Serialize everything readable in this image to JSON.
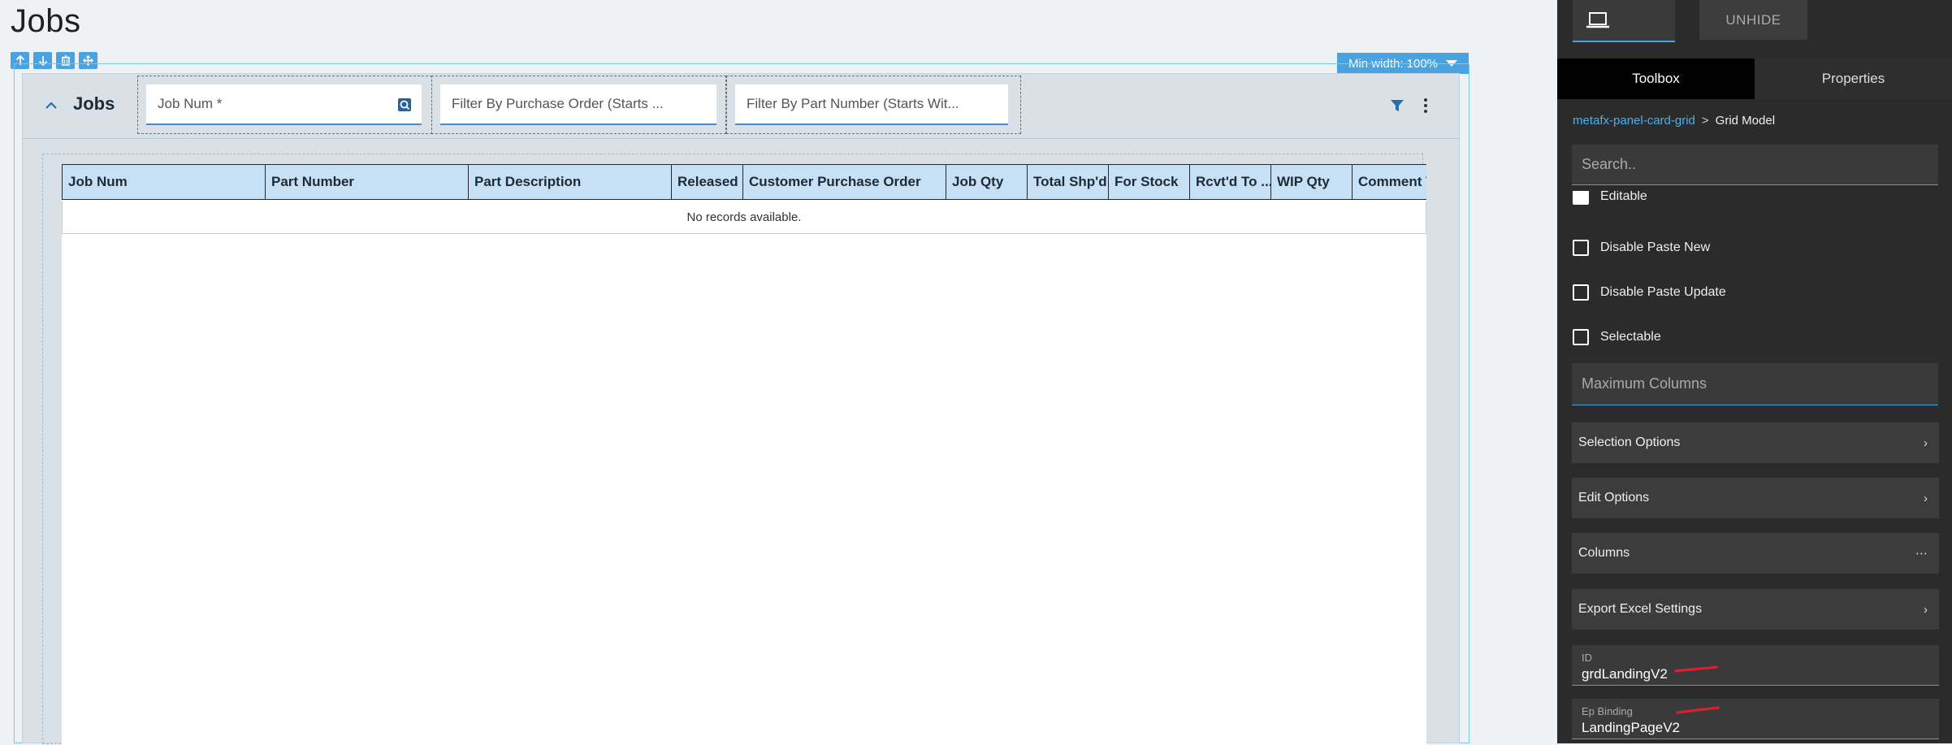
{
  "page": {
    "title": "Jobs"
  },
  "design": {
    "min_width_label": "Min width: 100%",
    "toolbar_icons": [
      "arrow-up-icon",
      "arrow-down-icon",
      "trash-icon",
      "move-icon"
    ]
  },
  "panel": {
    "title": "Jobs",
    "filters": {
      "job_num_placeholder": "Job Num *",
      "purchase_order_placeholder": "Filter By Purchase Order (Starts ...",
      "part_number_placeholder": "Filter By Part Number (Starts Wit..."
    }
  },
  "grid": {
    "columns": [
      "Job Num",
      "Part Number",
      "Part Description",
      "Released",
      "Customer Purchase Order",
      "Job Qty",
      "Total Shp'd",
      "For Stock",
      "Rcvt'd To ...",
      "WIP Qty",
      "Comment T"
    ],
    "empty_text": "No records available."
  },
  "sidepanel": {
    "unhide_label": "UNHIDE",
    "tabs": [
      "Toolbox",
      "Properties"
    ],
    "breadcrumb": {
      "link": "metafx-panel-card-grid",
      "separator": ">",
      "current": "Grid Model"
    },
    "search_placeholder": "Search..",
    "partial_label": "Editable",
    "checkboxes": [
      "Disable Paste New",
      "Disable Paste Update",
      "Selectable"
    ],
    "max_columns_placeholder": "Maximum Columns",
    "expanders": [
      {
        "label": "Selection Options",
        "icon": "chevron-right-icon"
      },
      {
        "label": "Edit Options",
        "icon": "chevron-right-icon"
      },
      {
        "label": "Columns",
        "icon": "ellipsis-icon"
      },
      {
        "label": "Export Excel Settings",
        "icon": "chevron-right-icon"
      }
    ],
    "id_field": {
      "label": "ID",
      "value": "grdLandingV2"
    },
    "ep_binding_field": {
      "label": "Ep Binding",
      "value": "LandingPageV2"
    }
  },
  "colors": {
    "accent": "#4aa3e0",
    "grid_header_bg": "#c6e0f5",
    "side_bg": "#2b2b2b",
    "annotation_red": "#e0202a"
  }
}
